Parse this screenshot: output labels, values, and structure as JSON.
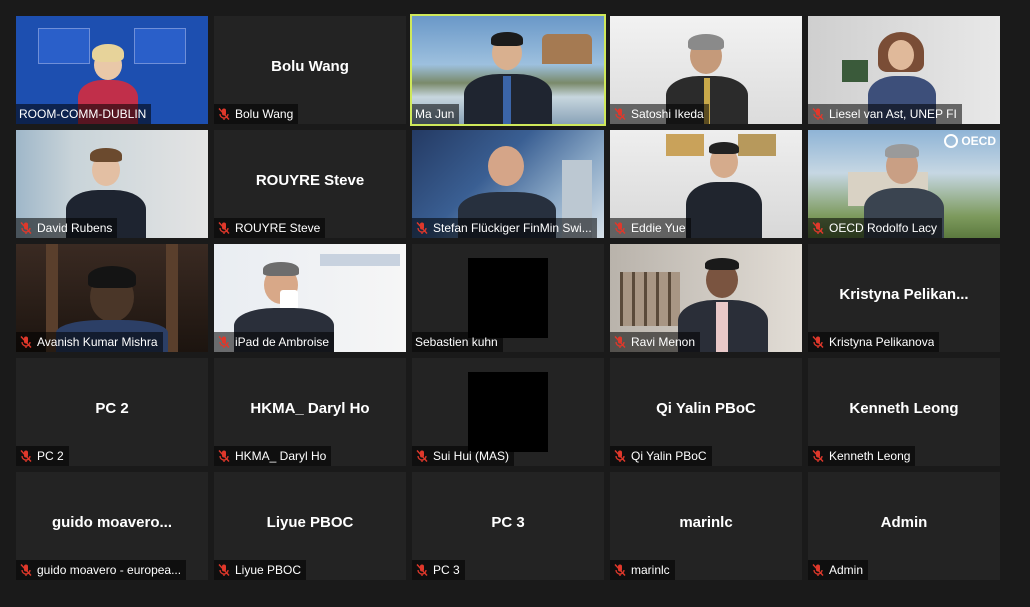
{
  "participants": [
    {
      "label": "ROOM-COMM-DUBLIN",
      "center": "",
      "muted": false,
      "kind": "eu"
    },
    {
      "label": "Bolu Wang",
      "center": "Bolu Wang",
      "muted": true,
      "kind": "name"
    },
    {
      "label": "Ma Jun",
      "center": "",
      "muted": false,
      "kind": "majun",
      "active": true
    },
    {
      "label": "Satoshi Ikeda",
      "center": "",
      "muted": true,
      "kind": "office"
    },
    {
      "label": "Liesel van Ast, UNEP FI",
      "center": "",
      "muted": true,
      "kind": "home"
    },
    {
      "label": "David Rubens",
      "center": "",
      "muted": true,
      "kind": "room"
    },
    {
      "label": "ROUYRE Steve",
      "center": "ROUYRE Steve",
      "muted": true,
      "kind": "name"
    },
    {
      "label": "Stefan Flückiger FinMin Swi...",
      "center": "",
      "muted": true,
      "kind": "city"
    },
    {
      "label": "Eddie Yue",
      "center": "",
      "muted": true,
      "kind": "office2"
    },
    {
      "label": "OECD Rodolfo Lacy",
      "center": "",
      "muted": true,
      "kind": "oecd",
      "logo": "OECD"
    },
    {
      "label": "Avanish Kumar Mishra",
      "center": "",
      "muted": true,
      "kind": "dark"
    },
    {
      "label": "iPad de Ambroise",
      "center": "",
      "muted": true,
      "kind": "bank"
    },
    {
      "label": "Sebastien kuhn",
      "center": "",
      "muted": false,
      "kind": "black"
    },
    {
      "label": "Ravi Menon",
      "center": "",
      "muted": true,
      "kind": "patio"
    },
    {
      "label": "Kristyna Pelikanova",
      "center": "Kristyna  Pelikan...",
      "muted": true,
      "kind": "name"
    },
    {
      "label": "PC 2",
      "center": "PC 2",
      "muted": true,
      "kind": "name"
    },
    {
      "label": "HKMA_ Daryl Ho",
      "center": "HKMA_ Daryl Ho",
      "muted": true,
      "kind": "name"
    },
    {
      "label": "Sui Hui (MAS)",
      "center": "",
      "muted": true,
      "kind": "black"
    },
    {
      "label": "Qi Yalin PBoC",
      "center": "Qi Yalin PBoC",
      "muted": true,
      "kind": "name"
    },
    {
      "label": "Kenneth Leong",
      "center": "Kenneth Leong",
      "muted": true,
      "kind": "name"
    },
    {
      "label": "guido moavero - europea...",
      "center": "guido  moavero...",
      "muted": true,
      "kind": "name"
    },
    {
      "label": "Liyue PBOC",
      "center": "Liyue PBOC",
      "muted": true,
      "kind": "name"
    },
    {
      "label": "PC 3",
      "center": "PC 3",
      "muted": true,
      "kind": "name"
    },
    {
      "label": "marinlc",
      "center": "marinlc",
      "muted": true,
      "kind": "name"
    },
    {
      "label": "Admin",
      "center": "Admin",
      "muted": true,
      "kind": "name"
    }
  ],
  "colors": {
    "background": "#1a1a1a",
    "tile": "#232323",
    "active_border": "#cfe85a",
    "mute_icon": "#e0382b"
  }
}
